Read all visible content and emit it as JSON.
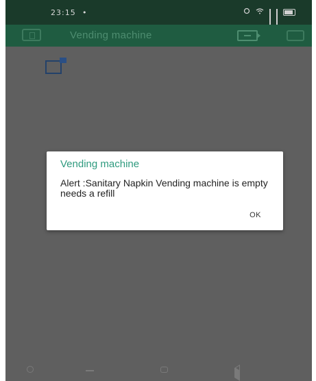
{
  "status_bar": {
    "time": "23:15",
    "indicator": "•"
  },
  "app_bar": {
    "title": "Vending machine",
    "left_icon": "device-icon",
    "login_icon": "login-icon",
    "right_icon": "square-icon"
  },
  "dialog": {
    "title": "Vending machine",
    "message": "Alert :Sanitary Napkin Vending machine is empty needs a refill",
    "ok_label": "OK"
  },
  "colors": {
    "app_bar": "#1f5c41",
    "status_bar": "#1a3a2a",
    "background": "#5f5f5f",
    "dialog_title": "#2e9a7e"
  }
}
